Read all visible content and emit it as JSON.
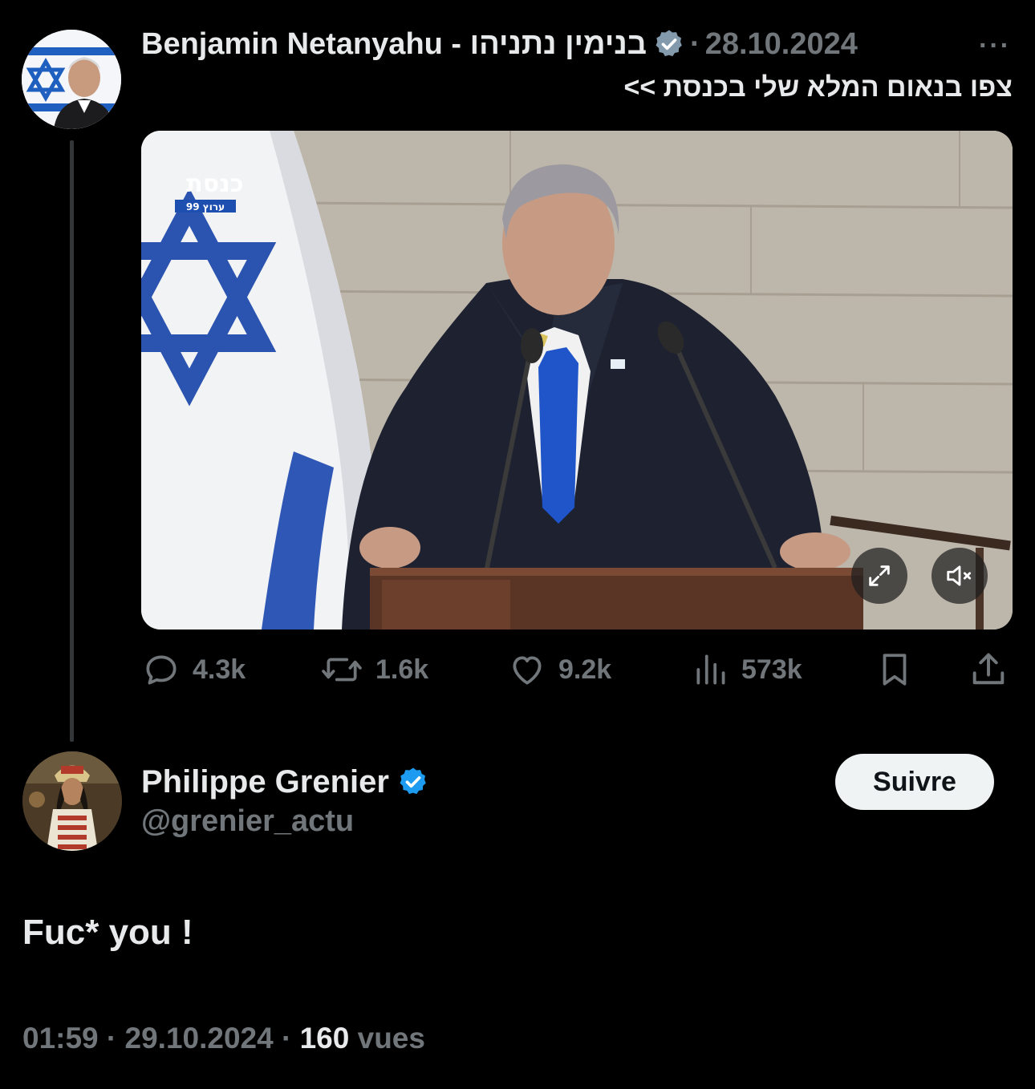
{
  "original_post": {
    "author_name": "Benjamin Netanyahu - בנימין נתניהו",
    "separator": "·",
    "date": "28.10.2024",
    "more_label": "···",
    "text": "צפו בנאום המלא שלי בכנסת >>",
    "media": {
      "channel_logo": "כנסת",
      "channel_sub": "ערוץ 99"
    },
    "stats": {
      "replies": "4.3k",
      "reposts": "1.6k",
      "likes": "9.2k",
      "views": "573k"
    }
  },
  "reply": {
    "author_name": "Philippe Grenier",
    "handle": "@grenier_actu",
    "follow_label": "Suivre",
    "text": "Fuc* you !",
    "time": "01:59",
    "date": "29.10.2024",
    "views_count": "160",
    "views_label": "vues"
  },
  "colors": {
    "background": "#000000",
    "primary_text": "#e7e9ea",
    "secondary_text": "#71767b",
    "verified_blue": "#1d9bf0",
    "verified_grey": "#829aab"
  },
  "icons": {
    "reply": "speech-bubble-icon",
    "repost": "repost-arrows-icon",
    "like": "heart-icon",
    "views": "bar-chart-icon",
    "bookmark": "bookmark-icon",
    "share": "share-upload-icon"
  }
}
